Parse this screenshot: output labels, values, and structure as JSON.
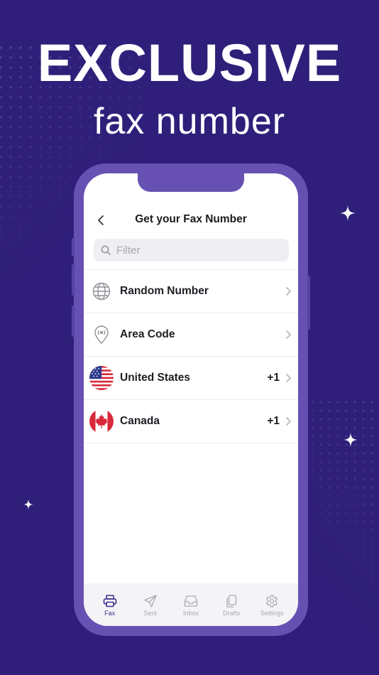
{
  "promo": {
    "headline": "EXCLUSIVE",
    "subheadline": "fax number"
  },
  "screen": {
    "title": "Get your Fax Number",
    "back_icon": "chevron-left-icon",
    "search": {
      "placeholder": "Filter",
      "value": "",
      "icon": "search-icon"
    }
  },
  "options": [
    {
      "label": "Random Number",
      "icon": "globe-icon",
      "code": ""
    },
    {
      "label": "Area Code",
      "icon": "location-pin-icon",
      "code": ""
    },
    {
      "label": "United States",
      "icon": "us-flag-icon",
      "code": "+1"
    },
    {
      "label": "Canada",
      "icon": "canada-flag-icon",
      "code": "+1"
    }
  ],
  "tabs": [
    {
      "label": "Fax",
      "icon": "printer-icon",
      "active": true
    },
    {
      "label": "Sent",
      "icon": "paper-plane-icon",
      "active": false
    },
    {
      "label": "Inbox",
      "icon": "inbox-tray-icon",
      "active": false
    },
    {
      "label": "Drafts",
      "icon": "documents-icon",
      "active": false
    },
    {
      "label": "Settings",
      "icon": "gear-icon",
      "active": false
    }
  ],
  "colors": {
    "background": "#2f1f7a",
    "phone_frame": "#6651b3",
    "accent": "#3d2a8e",
    "inactive_tab": "#a9a9b0"
  }
}
